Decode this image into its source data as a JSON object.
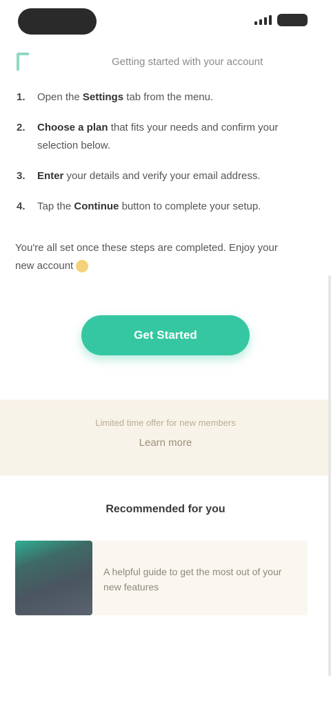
{
  "header": {
    "title": "Getting started with your account"
  },
  "steps": [
    {
      "num": "1.",
      "lead": "Open the",
      "bold": "Settings",
      "rest": "tab from the menu."
    },
    {
      "num": "2.",
      "lead": "",
      "bold": "Choose a plan",
      "rest": "that fits your needs and confirm your selection below."
    },
    {
      "num": "3.",
      "lead": "",
      "bold": "Enter",
      "rest": "your details and verify your email address."
    },
    {
      "num": "4.",
      "lead": "Tap the",
      "bold": "Continue",
      "rest": "button to complete your setup."
    }
  ],
  "note": "You're all set once these steps are completed. Enjoy your new account",
  "cta": {
    "label": "Get Started"
  },
  "promo": {
    "line1": "Limited time offer for new members",
    "line2": "Learn more"
  },
  "section": {
    "title": "Recommended for you"
  },
  "card": {
    "text": "A helpful guide to get the most out of your new features"
  },
  "colors": {
    "accent": "#35c7a1",
    "promo_bg": "#f8f3e9"
  }
}
